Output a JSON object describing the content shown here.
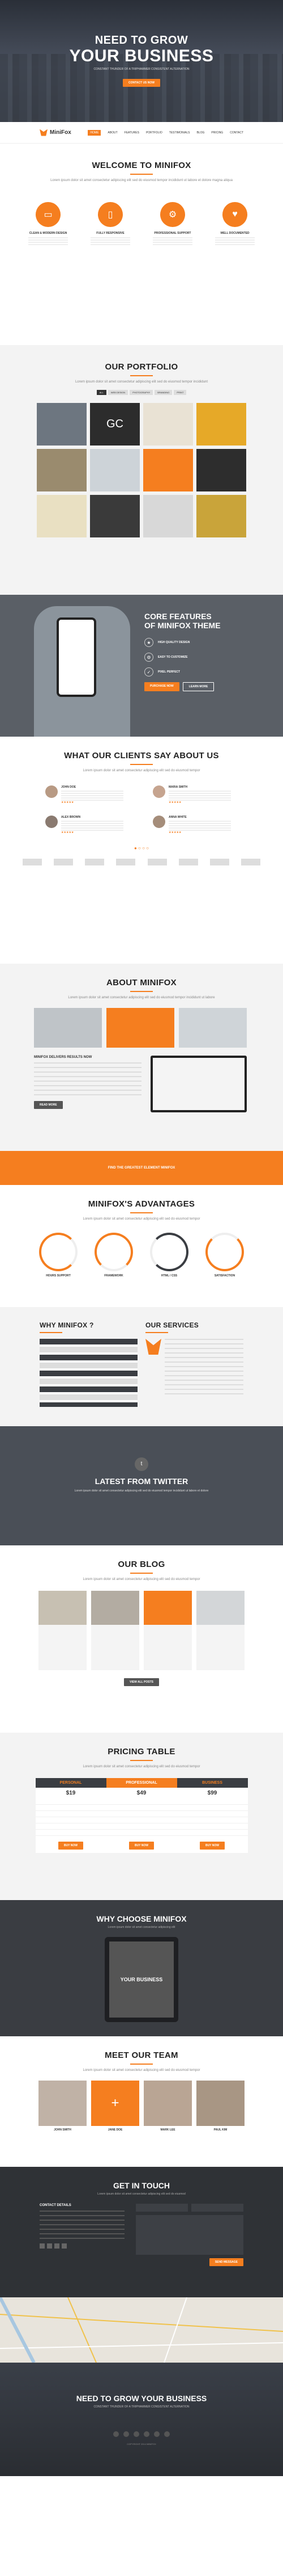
{
  "hero": {
    "title_line1": "NEED TO GROW",
    "title_line2": "YOUR BUSINESS",
    "subtitle": "CONSTANT THUNDER OF A TRIPHAMMER CONSISTENT ALTERNATION",
    "button": "CONTACT US NOW"
  },
  "nav": {
    "logo": "MiniFox",
    "items": [
      "HOME",
      "ABOUT",
      "FEATURES",
      "PORTFOLIO",
      "TESTIMONIALS",
      "BLOG",
      "PRICING",
      "CONTACT"
    ]
  },
  "welcome": {
    "title": "WELCOME TO MINIFOX",
    "subtitle": "Lorem ipsum dolor sit amet consectetur adipiscing elit sed do eiusmod tempor incididunt ut labore et dolore magna aliqua",
    "features": [
      {
        "icon": "desktop-icon",
        "title": "CLEAN & MODERN DESIGN"
      },
      {
        "icon": "mobile-icon",
        "title": "FULLY RESPONSIVE"
      },
      {
        "icon": "gear-icon",
        "title": "PROFESSIONAL SUPPORT"
      },
      {
        "icon": "heart-icon",
        "title": "WELL DOCUMENTED"
      }
    ]
  },
  "portfolio": {
    "title": "OUR PORTFOLIO",
    "subtitle": "Lorem ipsum dolor sit amet consectetur adipiscing elit sed do eiusmod tempor incididunt",
    "filters": [
      "ALL",
      "WEB DESIGN",
      "PHOTOGRAPHY",
      "BRANDING",
      "PRINT"
    ]
  },
  "features_dark": {
    "title_line1": "CORE FEATURES",
    "title_line2": "OF MINIFOX THEME",
    "items": [
      {
        "title": "HIGH QUALITY DESIGN"
      },
      {
        "title": "EASY TO CUSTOMIZE"
      },
      {
        "title": "PIXEL PERFECT"
      }
    ],
    "btn1": "PURCHASE NOW",
    "btn2": "LEARN MORE"
  },
  "testimonials": {
    "title": "WHAT OUR CLIENTS SAY ABOUT US",
    "subtitle": "Lorem ipsum dolor sit amet consectetur adipiscing elit sed do eiusmod tempor",
    "items": [
      {
        "name": "JOHN DOE"
      },
      {
        "name": "MARIA SMITH"
      },
      {
        "name": "ALEX BROWN"
      },
      {
        "name": "ANNA WHITE"
      }
    ]
  },
  "about": {
    "title": "ABOUT MINIFOX",
    "subtitle": "Lorem ipsum dolor sit amet consectetur adipiscing elit sed do eiusmod tempor incididunt ut labore",
    "list_title": "MINIFOX DELIVERS RESULTS NOW",
    "button": "READ MORE"
  },
  "banner": {
    "text": "FIND THE GREATEST ELEMENT MINIFOX"
  },
  "advantages": {
    "title": "MINIFOX'S ADVANTAGES",
    "subtitle": "Lorem ipsum dolor sit amet consectetur adipiscing elit sed do eiusmod tempor",
    "items": [
      {
        "label": "HOURS SUPPORT"
      },
      {
        "label": "FRAMEWORK"
      },
      {
        "label": "HTML / CSS"
      },
      {
        "label": "SATISFACTION"
      }
    ]
  },
  "why": {
    "title": "WHY MINIFOX ?"
  },
  "services": {
    "title": "OUR SERVICES"
  },
  "twitter": {
    "title": "LATEST FROM TWITTER",
    "text": "Lorem ipsum dolor sit amet consectetur adipiscing elit sed do eiusmod tempor incididunt ut labore et dolore"
  },
  "blog": {
    "title": "OUR BLOG",
    "subtitle": "Lorem ipsum dolor sit amet consectetur adipiscing elit sed do eiusmod tempor",
    "button": "VIEW ALL POSTS"
  },
  "pricing": {
    "title": "PRICING TABLE",
    "subtitle": "Lorem ipsum dolor sit amet consectetur adipiscing elit sed do eiusmod tempor",
    "plans": [
      {
        "name": "PERSONAL",
        "price": "$19",
        "btn": "BUY NOW"
      },
      {
        "name": "PROFESSIONAL",
        "price": "$49",
        "btn": "BUY NOW"
      },
      {
        "name": "BUSINESS",
        "price": "$99",
        "btn": "BUY NOW"
      }
    ]
  },
  "choose": {
    "title": "WHY CHOOSE MINIFOX",
    "subtitle": "Lorem ipsum dolor sit amet consectetur adipiscing elit",
    "screen_title": "YOUR BUSINESS"
  },
  "team": {
    "title": "MEET OUR TEAM",
    "subtitle": "Lorem ipsum dolor sit amet consectetur adipiscing elit sed do eiusmod tempor",
    "members": [
      {
        "name": "JOHN SMITH"
      },
      {
        "name": "JANE DOE"
      },
      {
        "name": "MARK LEE"
      },
      {
        "name": "PAUL KIM"
      }
    ]
  },
  "contact": {
    "title": "GET IN TOUCH",
    "subtitle": "Lorem ipsum dolor sit amet consectetur adipiscing elit sed do eiusmod",
    "info_title": "CONTACT DETAILS",
    "button": "SEND MESSAGE"
  },
  "footer": {
    "title": "NEED TO GROW YOUR BUSINESS",
    "subtitle": "CONSTANT THUNDER OF A TRIPHAMMER CONSISTENT ALTERNATION",
    "copy": "COPYRIGHT 2014 MINIFOX"
  },
  "colors": {
    "accent": "#f57e1f",
    "dark": "#3a3d42",
    "darker": "#2f3236"
  }
}
